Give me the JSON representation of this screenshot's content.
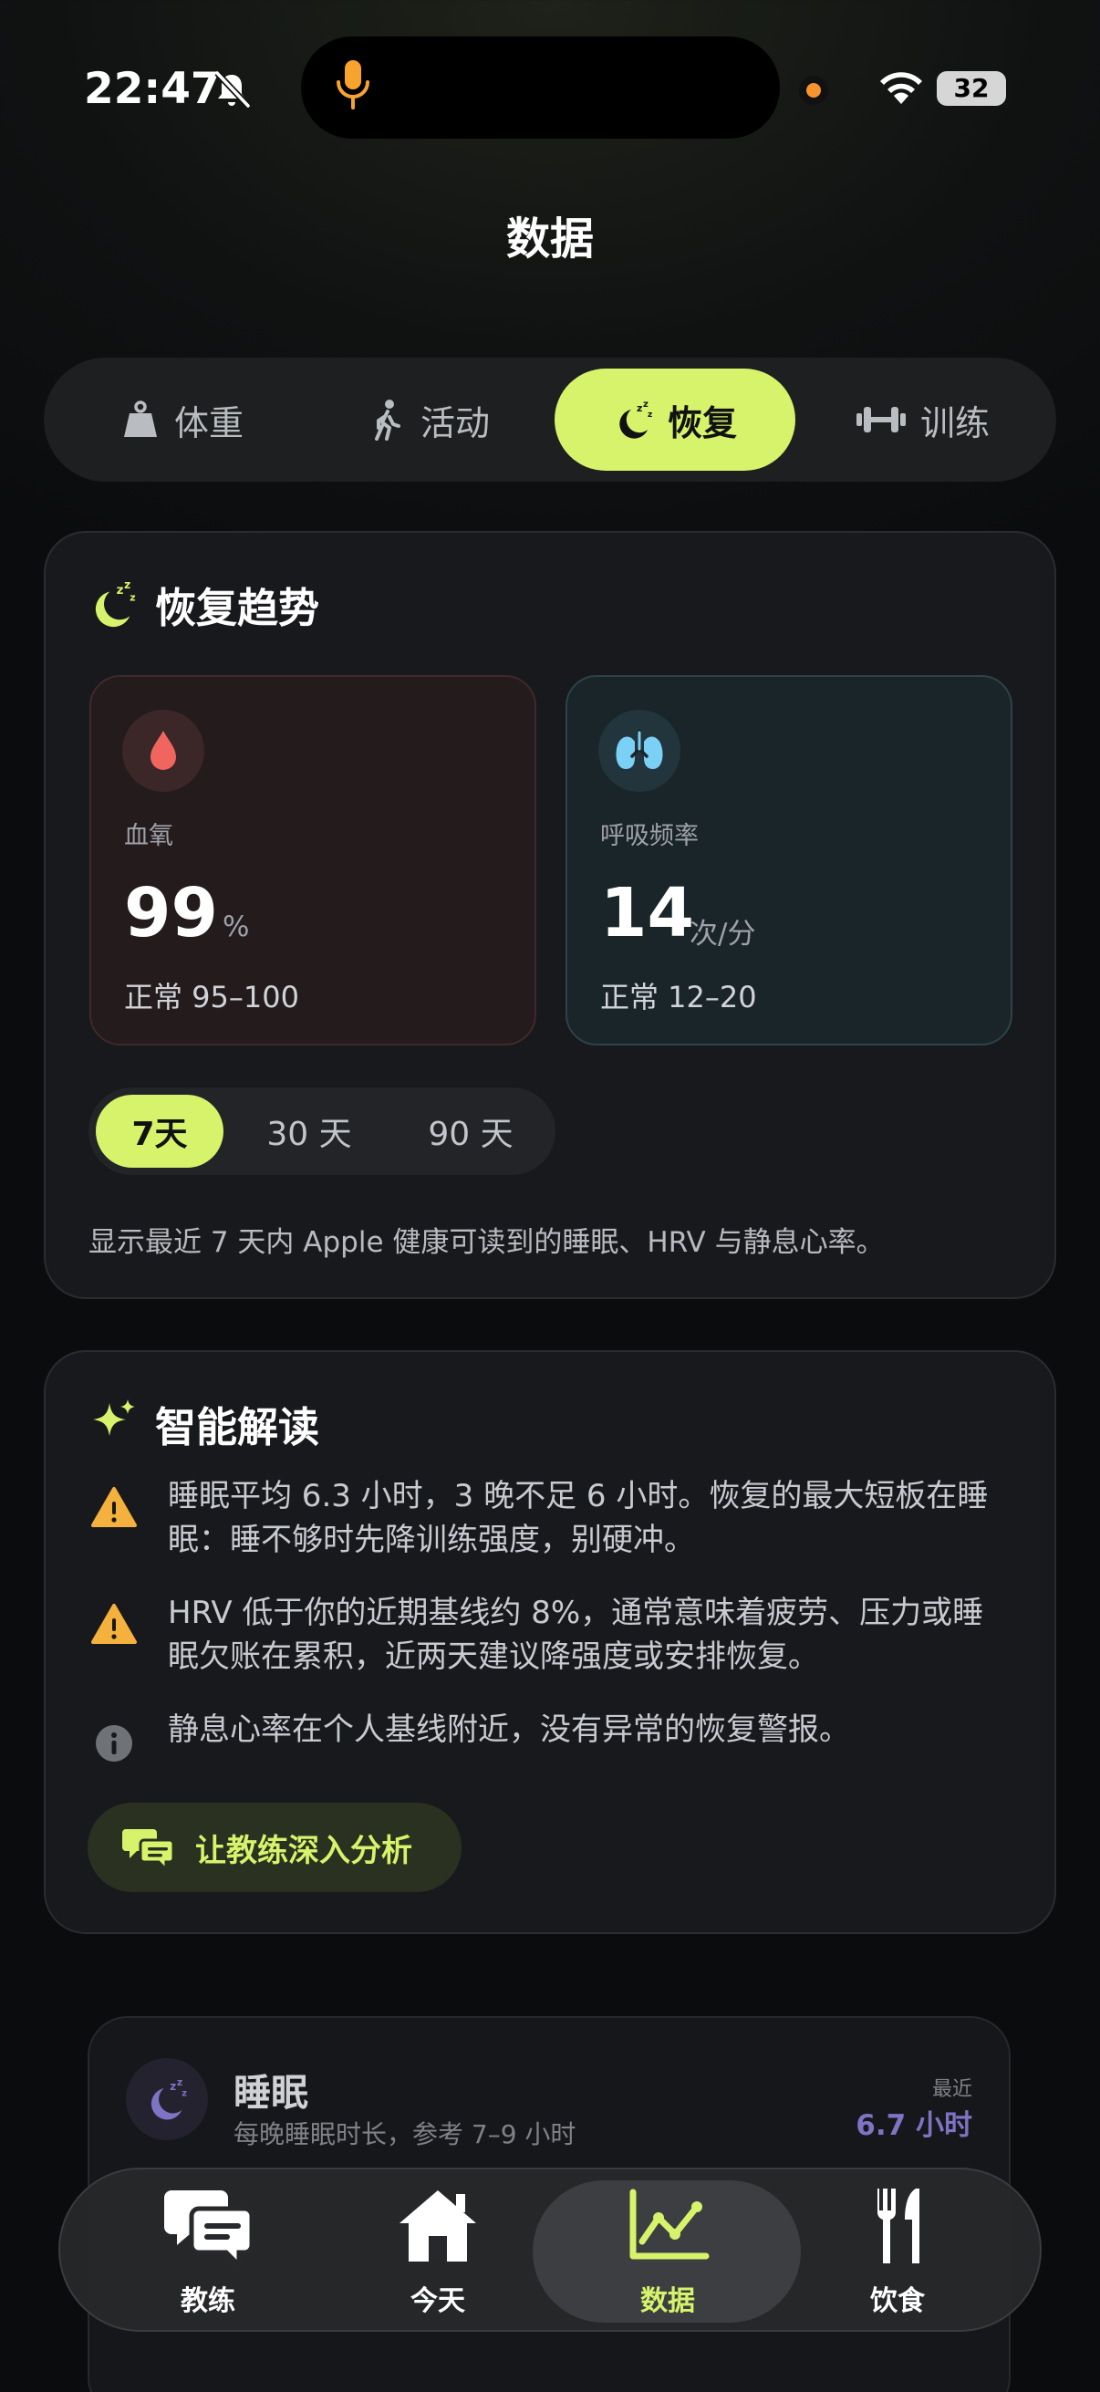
{
  "status_bar": {
    "time": "22:47",
    "battery": "32"
  },
  "page_title": "数据",
  "tabs": [
    {
      "label": "体重",
      "icon": "weight-icon"
    },
    {
      "label": "活动",
      "icon": "walking-icon"
    },
    {
      "label": "恢复",
      "icon": "moon-zzz-icon",
      "active": true
    },
    {
      "label": "训练",
      "icon": "dumbbell-icon"
    }
  ],
  "recovery_card": {
    "title": "恢复趋势",
    "metrics": [
      {
        "label": "血氧",
        "value": "99",
        "unit": "%",
        "range": "正常 95–100",
        "icon": "blood-drop-icon",
        "color": "#f0665f"
      },
      {
        "label": "呼吸频率",
        "value": "14",
        "unit": "次/分",
        "range": "正常 12–20",
        "icon": "lungs-icon",
        "color": "#7ad0f5"
      }
    ],
    "ranges": [
      "7天",
      "30 天",
      "90 天"
    ],
    "selected_range": "7天",
    "note": "显示最近 7 天内 Apple 健康可读到的睡眠、HRV 与静息心率。"
  },
  "insight_card": {
    "title": "智能解读",
    "items": [
      {
        "icon": "warning-icon",
        "text": "睡眠平均 6.3 小时，3 晚不足 6 小时。恢复的最大短板在睡眠：睡不够时先降训练强度，别硬冲。"
      },
      {
        "icon": "warning-icon",
        "text": "HRV 低于你的近期基线约 8%，通常意味着疲劳、压力或睡眠欠账在累积，近两天建议降强度或安排恢复。"
      },
      {
        "icon": "info-icon",
        "text": "静息心率在个人基线附近，没有异常的恢复警报。"
      }
    ],
    "coach_button": "让教练深入分析"
  },
  "sleep_card": {
    "title": "睡眠",
    "subtitle": "每晚睡眠时长，参考 7–9 小时",
    "latest_label": "最近",
    "latest_value": "6.7 小时"
  },
  "nav": [
    {
      "label": "教练",
      "icon": "chat-icon"
    },
    {
      "label": "今天",
      "icon": "home-icon"
    },
    {
      "label": "数据",
      "icon": "chart-icon",
      "active": true
    },
    {
      "label": "饮食",
      "icon": "fork-knife-icon"
    }
  ],
  "colors": {
    "accent": "#d6f36b",
    "warning": "#f5b13d",
    "sleep": "#7e73c4"
  }
}
